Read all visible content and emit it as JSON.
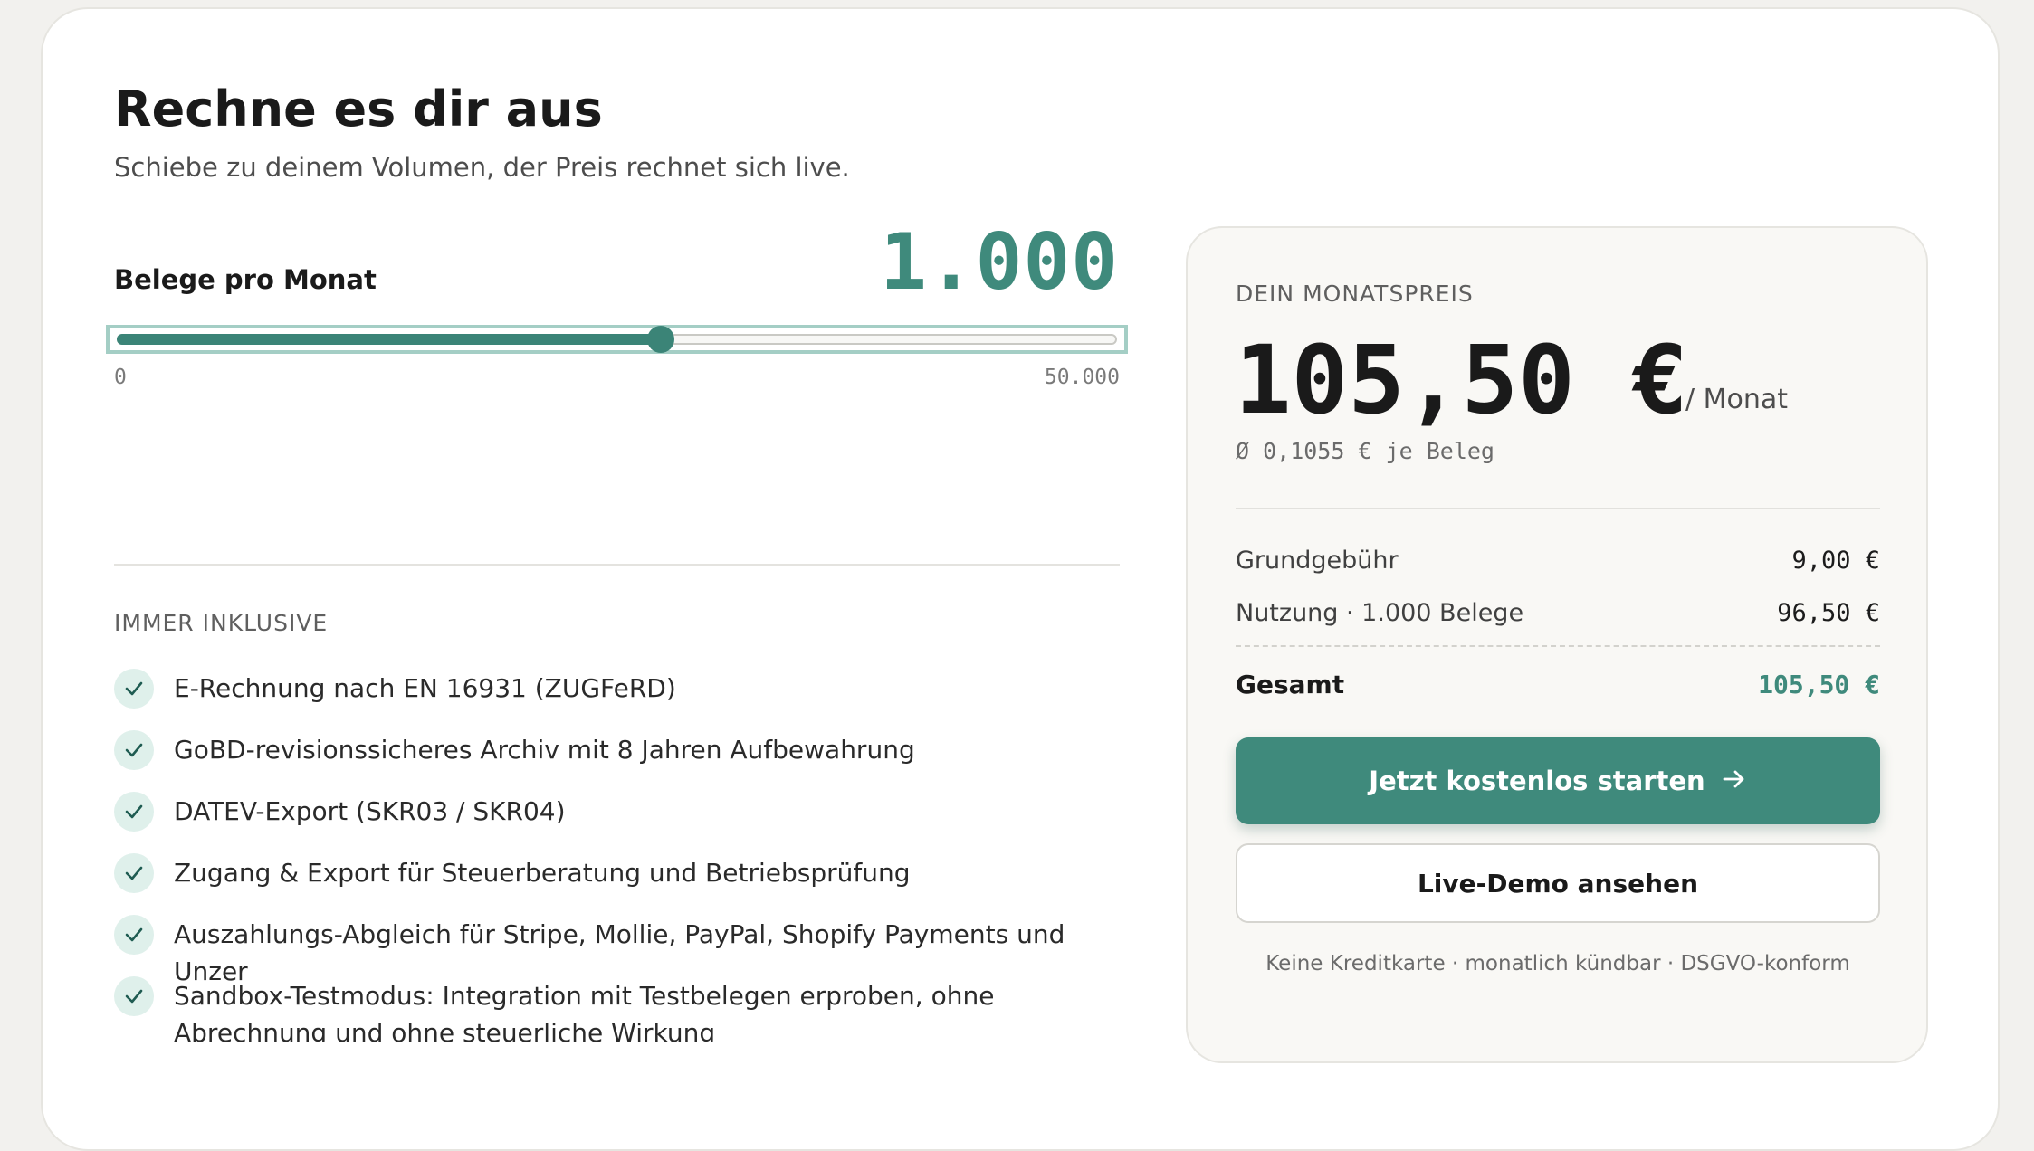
{
  "header": {
    "title": "Rechne es dir aus",
    "subtitle": "Schiebe zu deinem Volumen, der Preis rechnet sich live."
  },
  "slider": {
    "label": "Belege pro Monat",
    "value_display": "1.000",
    "min_label": "0",
    "max_label": "50.000"
  },
  "included": {
    "title": "IMMER INKLUSIVE",
    "items": [
      "E-Rechnung nach EN 16931 (ZUGFeRD)",
      "GoBD-revisionssicheres Archiv mit 8 Jahren Aufbewahrung",
      "DATEV-Export (SKR03 / SKR04)",
      "Zugang & Export für Steuerberatung und Betriebsprüfung",
      "Auszahlungs-Abgleich für Stripe, Mollie, PayPal, Shopify Payments und Unzer",
      "Sandbox-Testmodus: Integration mit Testbelegen erproben, ohne Abrechnung und ohne steuerliche Wirkung"
    ]
  },
  "price": {
    "label": "DEIN MONATSPREIS",
    "amount": "105,50 €",
    "per": "/ Monat",
    "avg": "Ø 0,1055 € je Beleg",
    "rows": [
      {
        "label": "Grundgebühr",
        "value": "9,00 €"
      },
      {
        "label": "Nutzung · 1.000 Belege",
        "value": "96,50 €"
      }
    ],
    "total_label": "Gesamt",
    "total_value": "105,50 €",
    "cta_primary": "Jetzt kostenlos starten",
    "cta_secondary": "Live-Demo ansehen",
    "note": "Keine Kreditkarte · monatlich kündbar · DSGVO-konform"
  },
  "colors": {
    "accent": "#3f8a7c",
    "check_bg": "#dff0eb"
  },
  "icons": {
    "check": "check-icon",
    "arrow": "arrow-right-icon"
  }
}
